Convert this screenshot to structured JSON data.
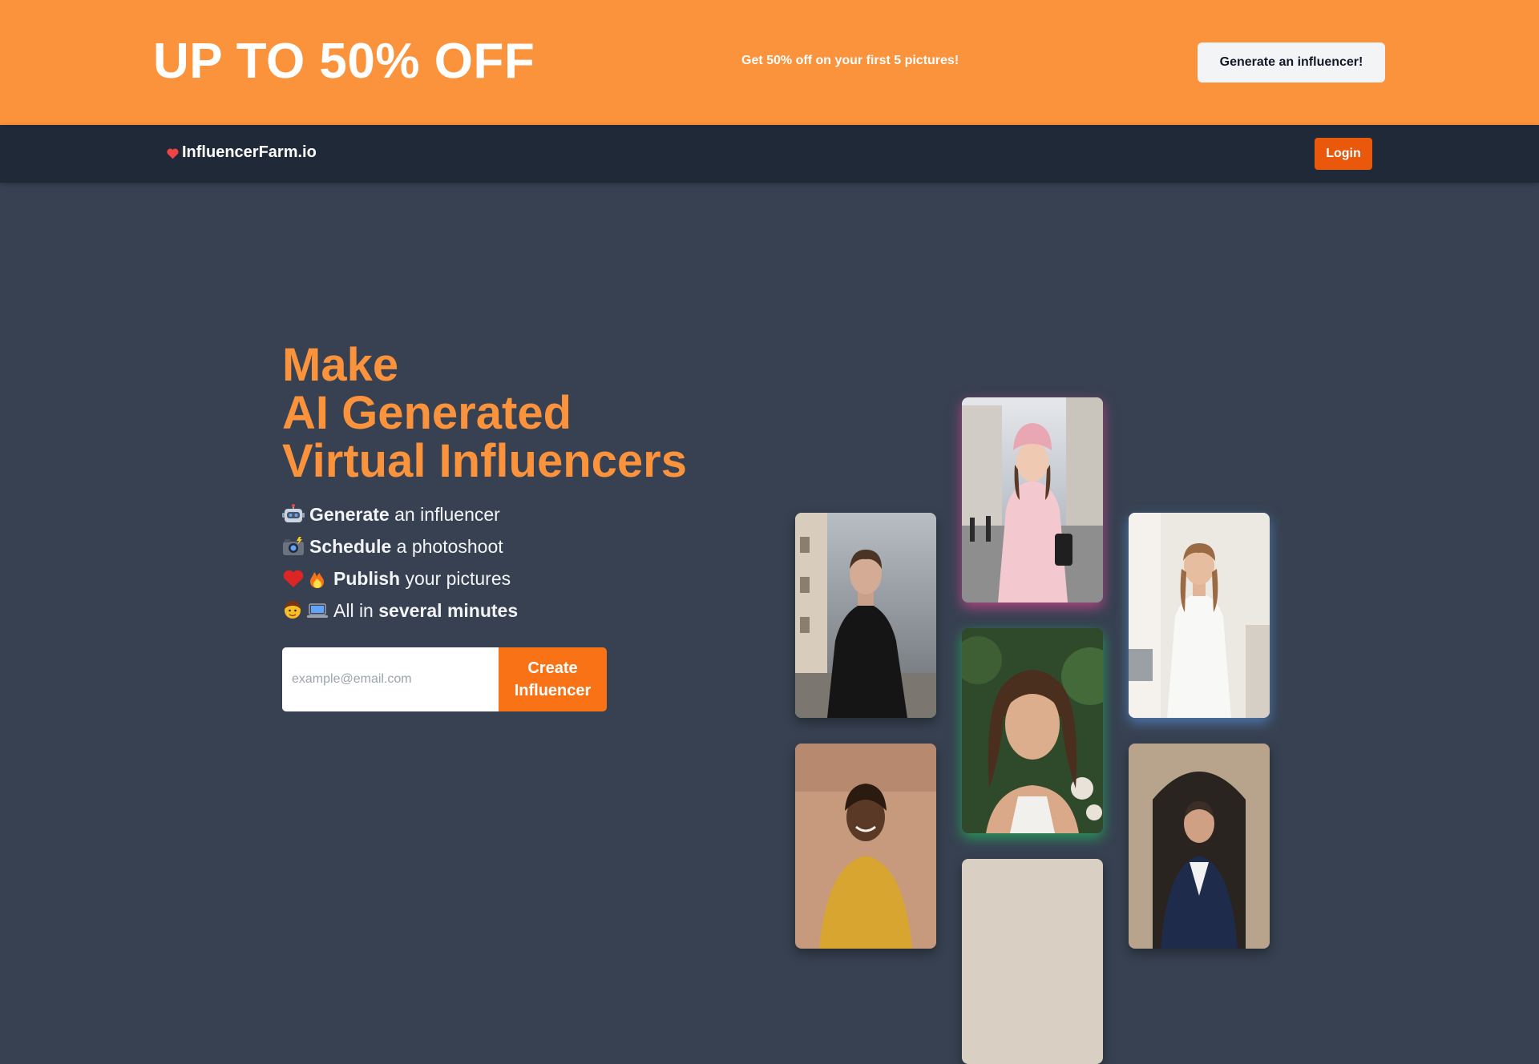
{
  "promo": {
    "title": "UP TO 50% OFF",
    "subtitle": "Get 50% off on your first 5 pictures!",
    "cta_label": "Generate an influencer!",
    "background": "#fb923c"
  },
  "nav": {
    "brand_icon": "heart-icon",
    "brand_name": "InfluencerFarm.io",
    "login_label": "Login",
    "accent": "#ea580c"
  },
  "hero": {
    "title_lines": [
      "Make",
      "AI Generated",
      "Virtual Influencers"
    ],
    "features": [
      {
        "emoji": "robot-icon",
        "bold": "Generate",
        "rest": " an influencer"
      },
      {
        "emoji": "camera-flash-icon",
        "bold": "Schedule",
        "rest": " a photoshoot"
      },
      {
        "emoji": "heart-fire-icon",
        "bold": "Publish",
        "rest": " your pictures"
      },
      {
        "emoji": "person-laptop-icon",
        "pre": "All in ",
        "bold": "several minutes"
      }
    ]
  },
  "signup": {
    "email_placeholder": "example@email.com",
    "create_label": "Create Influencer"
  },
  "gallery": {
    "photos": [
      {
        "name": "man-black-coat-photo",
        "subject": "man in black coat on city street"
      },
      {
        "name": "woman-pink-coat-photo",
        "subject": "woman in pink coat and beanie"
      },
      {
        "name": "woman-white-dress-photo",
        "subject": "woman in white dress in kitchen"
      },
      {
        "name": "woman-portrait-photo",
        "subject": "woman portrait with greenery"
      },
      {
        "name": "woman-yellow-outfit-photo",
        "subject": "smiling woman in yellow outfit"
      },
      {
        "name": "man-blue-blazer-photo",
        "subject": "man in blue blazer in archway"
      }
    ]
  }
}
